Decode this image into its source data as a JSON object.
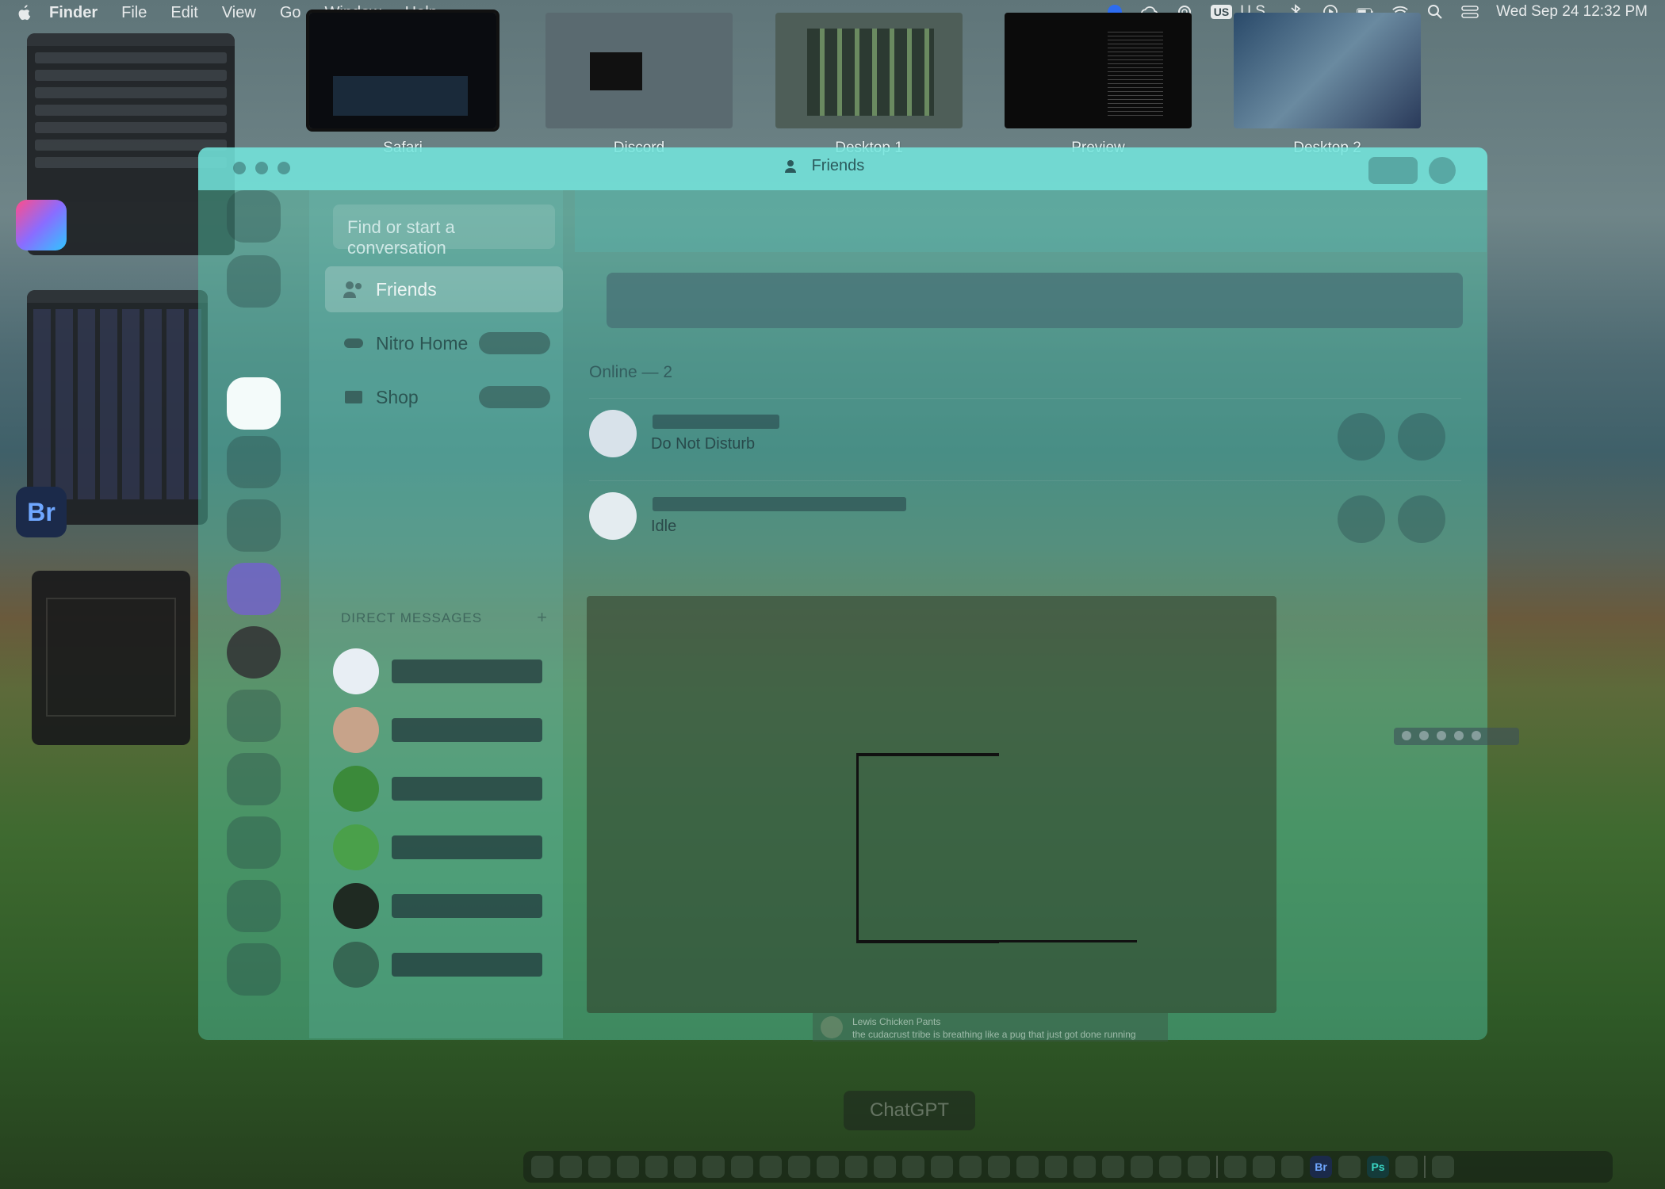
{
  "menubar": {
    "app_name": "Finder",
    "menus": [
      "File",
      "Edit",
      "View",
      "Go",
      "Window",
      "Help"
    ],
    "input_source": "US",
    "input_source_label": "U.S.",
    "datetime": "Wed Sep 24  12:32 PM"
  },
  "spaces": [
    {
      "label": "Safari",
      "active": true
    },
    {
      "label": "Discord",
      "active": false
    },
    {
      "label": "Desktop 1",
      "active": false
    },
    {
      "label": "Preview",
      "active": false
    },
    {
      "label": "Desktop 2",
      "active": false
    }
  ],
  "left_apps": {
    "bridge_label": "Br"
  },
  "discord": {
    "window_title": "Friends",
    "search_placeholder": "Find or start a conversation",
    "nav": [
      {
        "label": "Friends",
        "active": true
      },
      {
        "label": "Nitro Home",
        "active": false
      },
      {
        "label": "Shop",
        "active": false
      }
    ],
    "dm_header": "DIRECT MESSAGES",
    "dm_plus": "+",
    "online_label": "Online — 2",
    "friends": [
      {
        "status": "Do Not Disturb"
      },
      {
        "status": "Idle"
      }
    ],
    "message_preview": {
      "author": "Lewis Chicken Pants",
      "text": "the cudacrust tribe is breathing like a pug that just got done running"
    }
  },
  "chatgpt_label": "ChatGPT",
  "dock": {
    "bridge_label": "Br",
    "photoshop_label": "Ps"
  },
  "colors": {
    "discord_tint": "#54c8a8",
    "titlebar": "#78ebe6",
    "active_guild": "#f4fbfa"
  }
}
